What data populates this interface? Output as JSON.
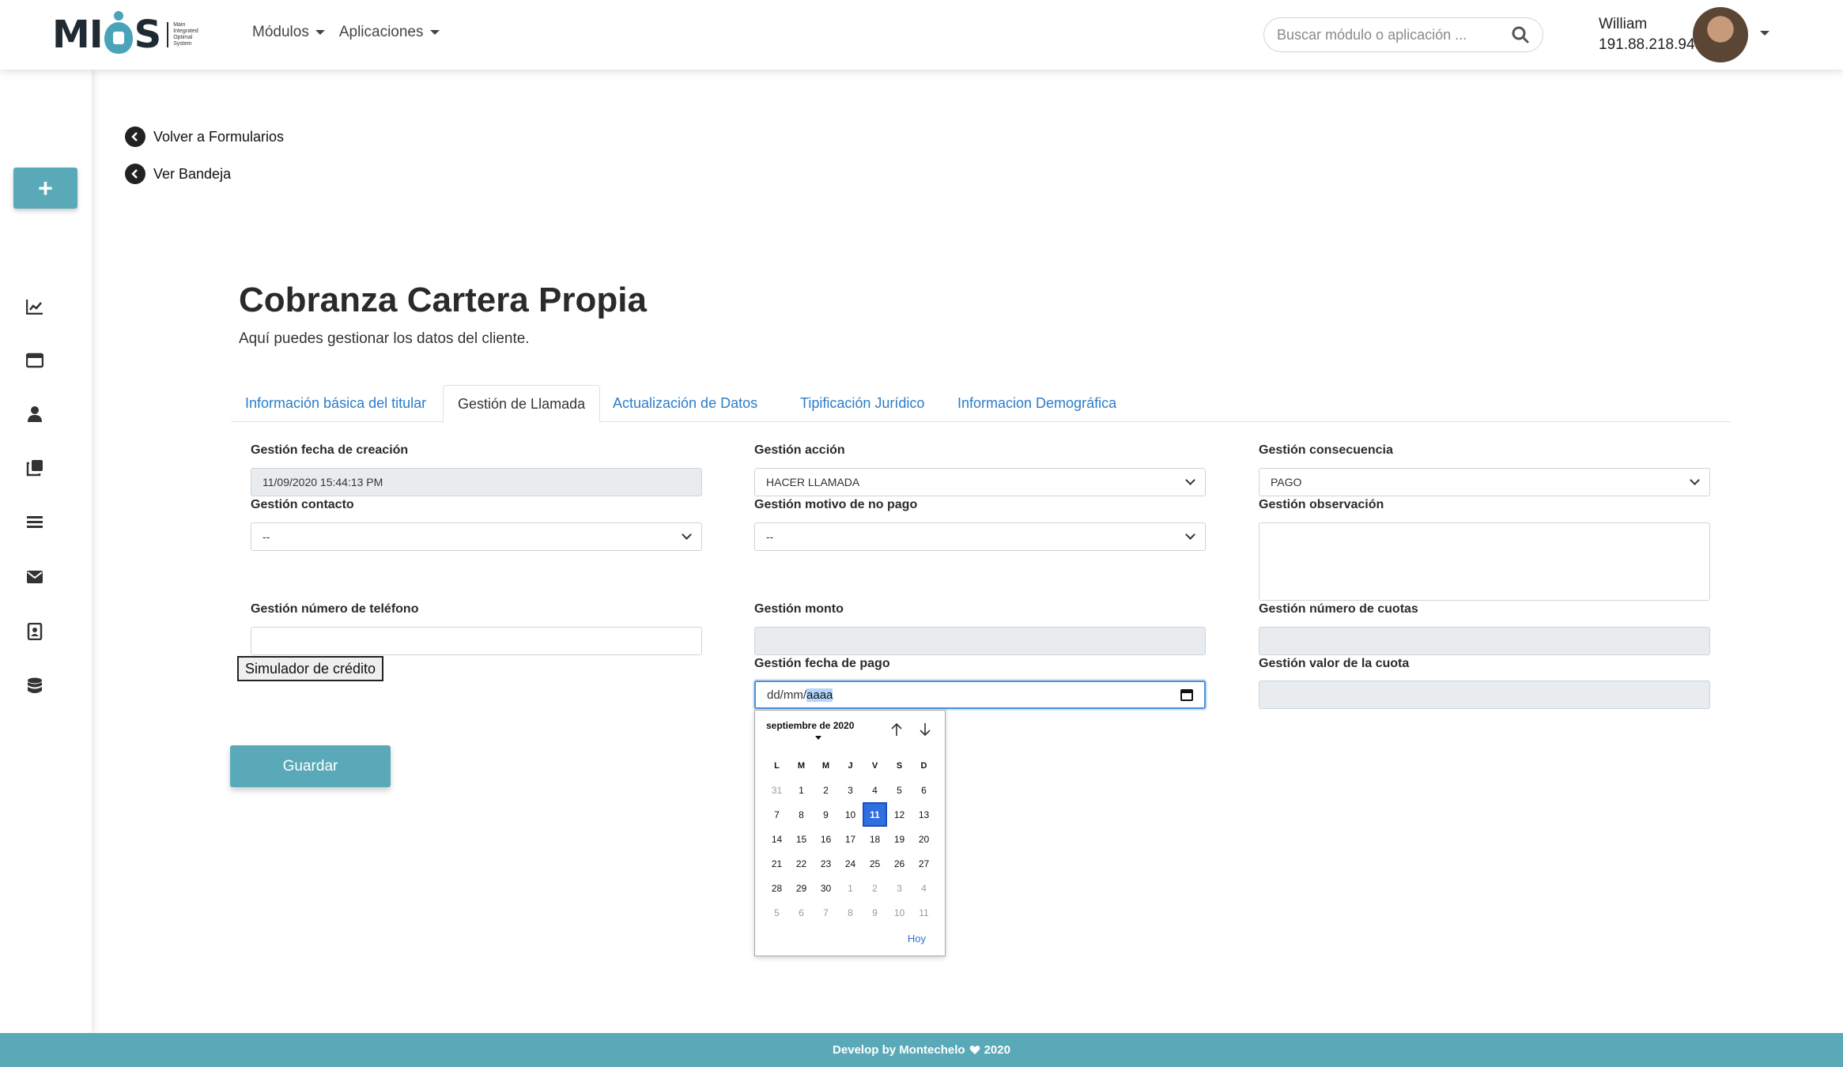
{
  "header": {
    "logo_text": "MIOS",
    "logo_subtitle": "Main Integrated Optimal System",
    "menu": [
      {
        "label": "Módulos"
      },
      {
        "label": "Aplicaciones"
      }
    ],
    "search_placeholder": "Buscar módulo o aplicación ...",
    "user_name": "William",
    "user_ip": "191.88.218.94"
  },
  "sidebar": {
    "add_label": "+",
    "icons": [
      "chart-line-icon",
      "window-icon",
      "user-icon",
      "copy-icon",
      "list-icon",
      "envelope-icon",
      "address-book-icon",
      "database-icon"
    ]
  },
  "links": {
    "back_forms": "Volver a Formularios",
    "view_inbox": "Ver Bandeja"
  },
  "page": {
    "title": "Cobranza Cartera Propia",
    "subtitle": "Aquí puedes gestionar los datos del cliente."
  },
  "tabs": [
    {
      "label": "Información básica del titular"
    },
    {
      "label": "Gestión de Llamada"
    },
    {
      "label": "Actualización de Datos"
    },
    {
      "label": "Tipificación Jurídico"
    },
    {
      "label": "Informacion Demográfica"
    }
  ],
  "form": {
    "fecha_creacion": {
      "label": "Gestión fecha de creación",
      "value": "11/09/2020 15:44:13 PM"
    },
    "accion": {
      "label": "Gestión acción",
      "value": "HACER LLAMADA"
    },
    "consecuencia": {
      "label": "Gestión consecuencia",
      "value": "PAGO"
    },
    "contacto": {
      "label": "Gestión contacto",
      "value": "--"
    },
    "motivo_no_pago": {
      "label": "Gestión motivo de no pago",
      "value": "--"
    },
    "observacion": {
      "label": "Gestión observación"
    },
    "numero_telefono": {
      "label": "Gestión número de teléfono",
      "value": ""
    },
    "monto": {
      "label": "Gestión monto",
      "value": ""
    },
    "numero_cuotas": {
      "label": "Gestión número de cuotas",
      "value": ""
    },
    "fecha_pago": {
      "label": "Gestión fecha de pago",
      "prefix": "dd/mm/",
      "selected": "aaaa"
    },
    "valor_cuota": {
      "label": "Gestión valor de la cuota",
      "value": ""
    },
    "simulator_button": "Simulador de crédito",
    "save_button": "Guardar"
  },
  "datepicker": {
    "month_label": "septiembre de 2020",
    "weekdays": [
      "L",
      "M",
      "M",
      "J",
      "V",
      "S",
      "D"
    ],
    "weeks": [
      [
        {
          "d": "31",
          "o": true
        },
        {
          "d": "1"
        },
        {
          "d": "2"
        },
        {
          "d": "3"
        },
        {
          "d": "4"
        },
        {
          "d": "5"
        },
        {
          "d": "6"
        }
      ],
      [
        {
          "d": "7"
        },
        {
          "d": "8"
        },
        {
          "d": "9"
        },
        {
          "d": "10"
        },
        {
          "d": "11",
          "s": true
        },
        {
          "d": "12"
        },
        {
          "d": "13"
        }
      ],
      [
        {
          "d": "14"
        },
        {
          "d": "15"
        },
        {
          "d": "16"
        },
        {
          "d": "17"
        },
        {
          "d": "18"
        },
        {
          "d": "19"
        },
        {
          "d": "20"
        }
      ],
      [
        {
          "d": "21"
        },
        {
          "d": "22"
        },
        {
          "d": "23"
        },
        {
          "d": "24"
        },
        {
          "d": "25"
        },
        {
          "d": "26"
        },
        {
          "d": "27"
        }
      ],
      [
        {
          "d": "28"
        },
        {
          "d": "29"
        },
        {
          "d": "30"
        },
        {
          "d": "1",
          "o": true
        },
        {
          "d": "2",
          "o": true
        },
        {
          "d": "3",
          "o": true
        },
        {
          "d": "4",
          "o": true
        }
      ],
      [
        {
          "d": "5",
          "o": true
        },
        {
          "d": "6",
          "o": true
        },
        {
          "d": "7",
          "o": true
        },
        {
          "d": "8",
          "o": true
        },
        {
          "d": "9",
          "o": true
        },
        {
          "d": "10",
          "o": true
        },
        {
          "d": "11",
          "o": true
        }
      ]
    ],
    "today_label": "Hoy"
  },
  "footer": {
    "text_before": "Develop by Montechelo",
    "text_after": "2020"
  },
  "colors": {
    "accent": "#5aa9b8",
    "link": "#2a7dc9",
    "selected_day": "#2f6fe0"
  }
}
